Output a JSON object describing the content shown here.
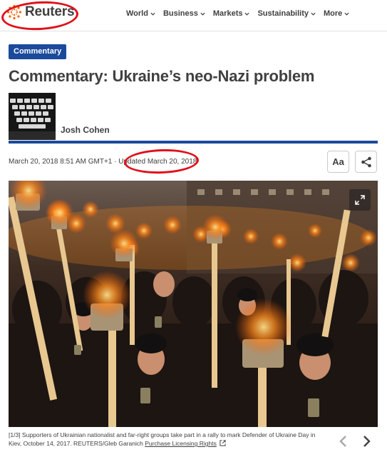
{
  "header": {
    "logo_text": "Reuters",
    "brand_color": "#fa6400",
    "nav": [
      {
        "label": "World"
      },
      {
        "label": "Business"
      },
      {
        "label": "Markets"
      },
      {
        "label": "Sustainability"
      },
      {
        "label": "More"
      }
    ]
  },
  "article": {
    "category": "Commentary",
    "title": "Commentary: Ukraine’s neo-Nazi problem",
    "author": "Josh Cohen",
    "dateline": "March 20, 2018 8:51 AM GMT+1 · Updated March 20, 2018",
    "text_size_label": "Aa",
    "accent_color": "#1b4a9c",
    "annotation_color": "#e0101a"
  },
  "gallery": {
    "counter": "[1/3]",
    "caption_line1": "Supporters of Ukrainian nationalist and far-right groups take part in a rally to mark Defender of Ukraine Day in",
    "caption_line2": "Kiev, October 14, 2017. REUTERS/Gleb Garanich",
    "licensing_link": "Purchase Licensing Rights",
    "icons": [
      "expand-icon",
      "external-link-icon",
      "chevron-left-icon",
      "chevron-right-icon",
      "share-icon"
    ]
  }
}
